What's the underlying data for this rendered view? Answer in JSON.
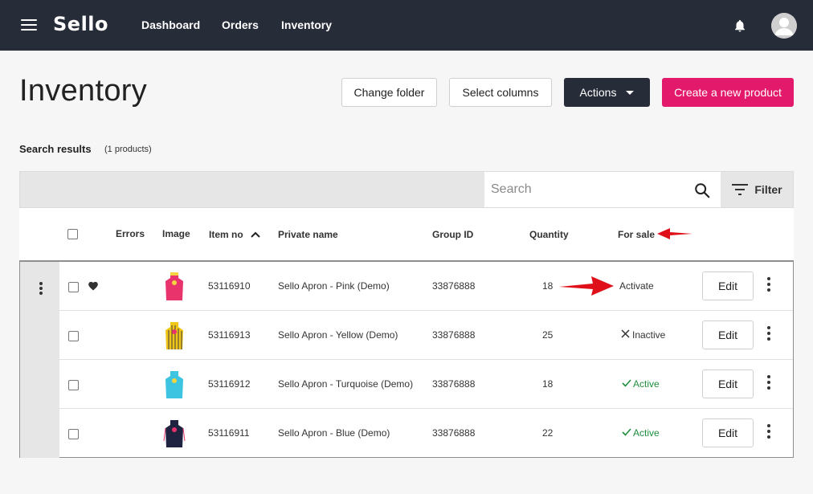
{
  "nav": {
    "logo": "Sello",
    "links": [
      "Dashboard",
      "Orders",
      "Inventory"
    ],
    "menu_icon": "hamburger-icon",
    "notifications_icon": "bell-icon",
    "avatar_icon": "user-avatar-icon"
  },
  "page": {
    "title": "Inventory",
    "buttons": {
      "change_folder": "Change folder",
      "select_columns": "Select columns",
      "actions": "Actions",
      "create": "Create a new product"
    },
    "results_label": "Search results",
    "results_count": "(1 products)"
  },
  "search": {
    "placeholder": "Search",
    "value": "",
    "filter_label": "Filter"
  },
  "table": {
    "columns": {
      "errors": "Errors",
      "image": "Image",
      "item_no": "Item no",
      "private_name": "Private name",
      "group_id": "Group ID",
      "quantity": "Quantity",
      "for_sale": "For sale"
    },
    "sort": {
      "column": "item_no",
      "direction": "ascending"
    },
    "rows": [
      {
        "favorite": true,
        "item_no": "53116910",
        "name": "Sello Apron - Pink (Demo)",
        "group_id": "33876888",
        "quantity": "18",
        "for_sale": "Activate",
        "status": "activate",
        "edit": "Edit",
        "apron_color": "#e8336d",
        "apron_stripe": "none"
      },
      {
        "favorite": false,
        "item_no": "53116913",
        "name": "Sello Apron - Yellow (Demo)",
        "group_id": "33876888",
        "quantity": "25",
        "for_sale": "Inactive",
        "status": "inactive",
        "edit": "Edit",
        "apron_color": "#f2c619",
        "apron_stripe": "#3a3a3a"
      },
      {
        "favorite": false,
        "item_no": "53116912",
        "name": "Sello Apron - Turquoise (Demo)",
        "group_id": "33876888",
        "quantity": "18",
        "for_sale": "Active",
        "status": "active",
        "edit": "Edit",
        "apron_color": "#3cc4e0",
        "apron_stripe": "none"
      },
      {
        "favorite": false,
        "item_no": "53116911",
        "name": "Sello Apron - Blue (Demo)",
        "group_id": "33876888",
        "quantity": "22",
        "for_sale": "Active",
        "status": "active",
        "edit": "Edit",
        "apron_color": "#1f2340",
        "apron_stripe": "none"
      }
    ]
  },
  "colors": {
    "topbar": "#272c39",
    "primary_pink": "#e3196b",
    "active_green": "#1e8e3e",
    "annotation_red": "#e0101a"
  }
}
